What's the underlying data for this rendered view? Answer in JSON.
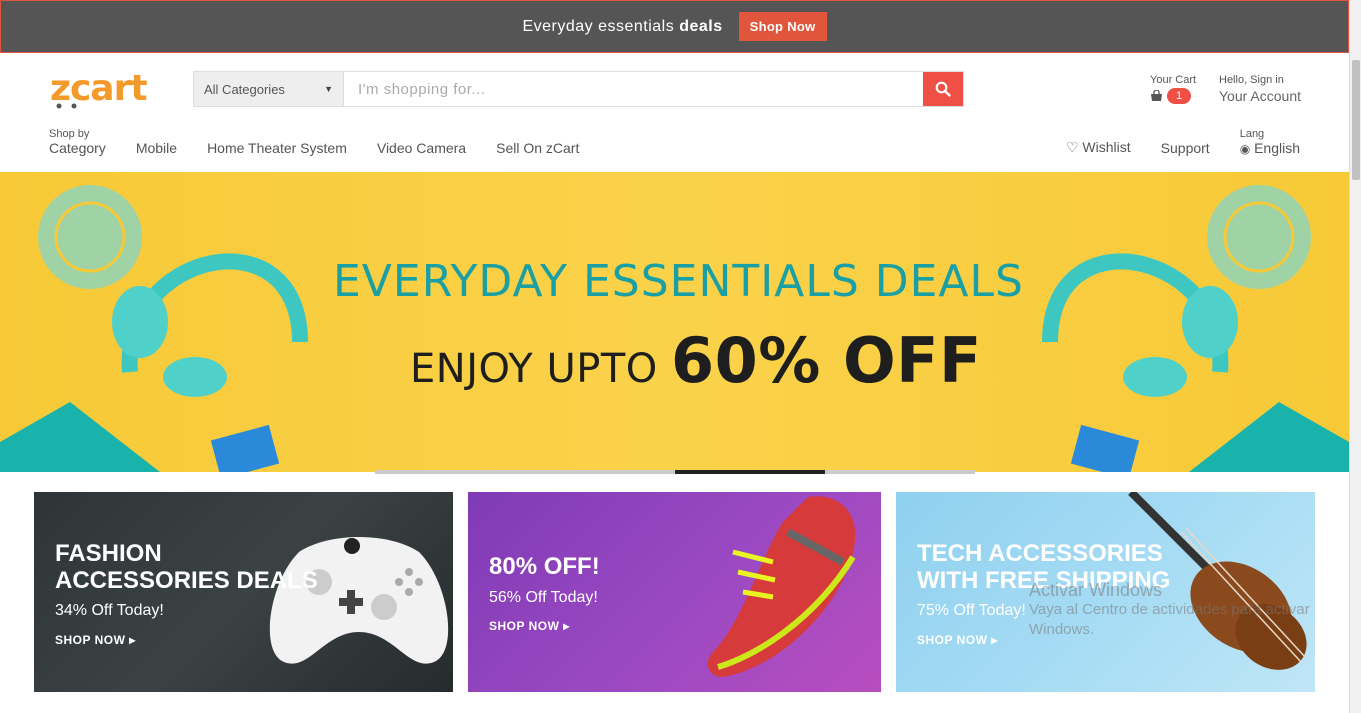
{
  "promo_bar": {
    "text": "Everyday essentials",
    "text_bold": "deals",
    "button_label": "Shop Now"
  },
  "header": {
    "logo": "zcart",
    "search": {
      "category": "All Categories",
      "placeholder": "I'm shopping for..."
    },
    "cart": {
      "label": "Your Cart",
      "count": "1"
    },
    "account": {
      "greeting": "Hello, Sign in",
      "label": "Your Account"
    }
  },
  "nav": {
    "shop_by_small": "Shop by",
    "shop_by_label": "Category",
    "items": [
      "Mobile",
      "Home Theater System",
      "Video Camera",
      "Sell On zCart"
    ],
    "wishlist": "Wishlist",
    "support": "Support",
    "lang_small": "Lang",
    "lang_label": "English"
  },
  "banner": {
    "title": "EVERYDAY ESSENTIALS DEALS",
    "sub_prefix": "ENJOY UPTO",
    "sub_bold": "60% OFF"
  },
  "cards": [
    {
      "title_line1": "FASHION",
      "title_line2": "ACCESSORIES DEALS",
      "sub": "34% Off Today!",
      "link": "SHOP NOW ▸"
    },
    {
      "title_line1": "80% OFF!",
      "title_line2": "",
      "sub": "56% Off Today!",
      "link": "SHOP NOW ▸"
    },
    {
      "title_line1": "TECH ACCESSORIES",
      "title_line2": "WITH FREE SHIPPING",
      "sub": "75% Off Today!",
      "link": "SHOP NOW ▸"
    }
  ],
  "watermark": {
    "title": "Activar Windows",
    "line1": "Vaya al Centro de actividades para activar",
    "line2": "Windows."
  },
  "colors": {
    "accent": "#ef4f45",
    "brand": "#f39a2b",
    "banner_teal": "#1aa0a4",
    "banner_yellow": "#f7c937"
  },
  "icons": [
    "search-icon",
    "cart-icon",
    "heart-icon",
    "globe-icon",
    "chevron-down-icon"
  ]
}
